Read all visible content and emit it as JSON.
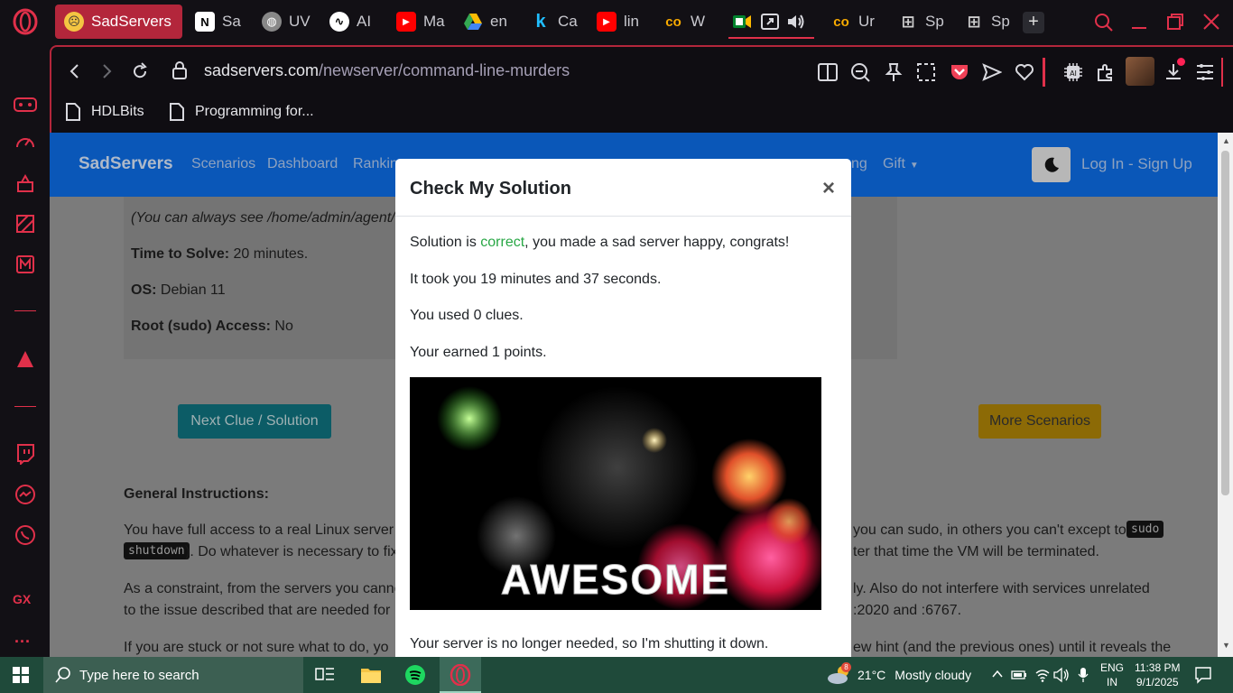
{
  "browser": {
    "tabs": [
      {
        "label": "SadServers",
        "active": true
      },
      {
        "label": "Sa"
      },
      {
        "label": "UV"
      },
      {
        "label": "AI"
      },
      {
        "label": "Ma"
      },
      {
        "label": "en"
      },
      {
        "label": "Ca"
      },
      {
        "label": "lin"
      },
      {
        "label": "W"
      },
      {
        "label": "Ur"
      },
      {
        "label": "Sp"
      },
      {
        "label": "Sp"
      }
    ],
    "url_domain": "sadservers.com",
    "url_path": "/newserver/command-line-murders",
    "bookmarks": [
      "HDLBits",
      "Programming for..."
    ],
    "sidebar_gx_label": "GX",
    "sidebar_more": "..."
  },
  "site": {
    "brand": "SadServers",
    "nav": [
      "Scenarios",
      "Dashboard",
      "Rankin",
      "ng",
      "Gift"
    ],
    "login": "Log In",
    "signup": "Sign Up",
    "sep": "-"
  },
  "content": {
    "see_note": "(You can always see /home/admin/agent/",
    "time_label": "Time to Solve:",
    "time_value": " 20 minutes.",
    "os_label": "OS:",
    "os_value": " Debian 11",
    "root_label": "Root (sudo) Access:",
    "root_value": " No",
    "next_clue_btn": "Next Clue / Solution",
    "more_scenarios_btn": "More Scenarios",
    "general_heading": "General Instructions:",
    "para1_a": "You have full access to a real Linux server (",
    "para1_b": "you can sudo, in others you can't except to",
    "code_sudo": "sudo",
    "code_shutdown": "shutdown",
    "para1_c": "). Do whatever is necessary to fix",
    "para1_d": "ter that time the VM will be terminated.",
    "para2_a": "As a constraint, from the servers you canno",
    "para2_b": "ly. Also do not interfere with services unrelated",
    "para2_c": "to the issue described that are needed for",
    "para2_d": ":2020 and :6767.",
    "para3_a": "If you are stuck or not sure what to do, yo",
    "para3_b": "ew hint (and the previous ones) until it reveals the"
  },
  "modal": {
    "title": "Check My Solution",
    "close": "×",
    "line1_a": "Solution is ",
    "line1_correct": "correct",
    "line1_b": ", you made a sad server happy, congrats!",
    "line2": "It took you 19 minutes and 37 seconds.",
    "line3": "You used 0 clues.",
    "line4": "Your earned 1 points.",
    "image_text": "AWESOME",
    "line5": "Your server is no longer needed, so I'm shutting it down."
  },
  "taskbar": {
    "search_placeholder": "Type here to search",
    "weather_temp": "21°C",
    "weather_desc": "Mostly cloudy",
    "lang1": "ENG",
    "lang2": "IN",
    "time": "11:38 PM",
    "date": "9/1/2025",
    "weather_badge": "8"
  },
  "colors": {
    "opera_red": "#e0304a",
    "navbar_blue": "#0a57b8",
    "btn_teal": "#17a2b8",
    "btn_yellow": "#ffc107",
    "correct_green": "#28a745"
  }
}
